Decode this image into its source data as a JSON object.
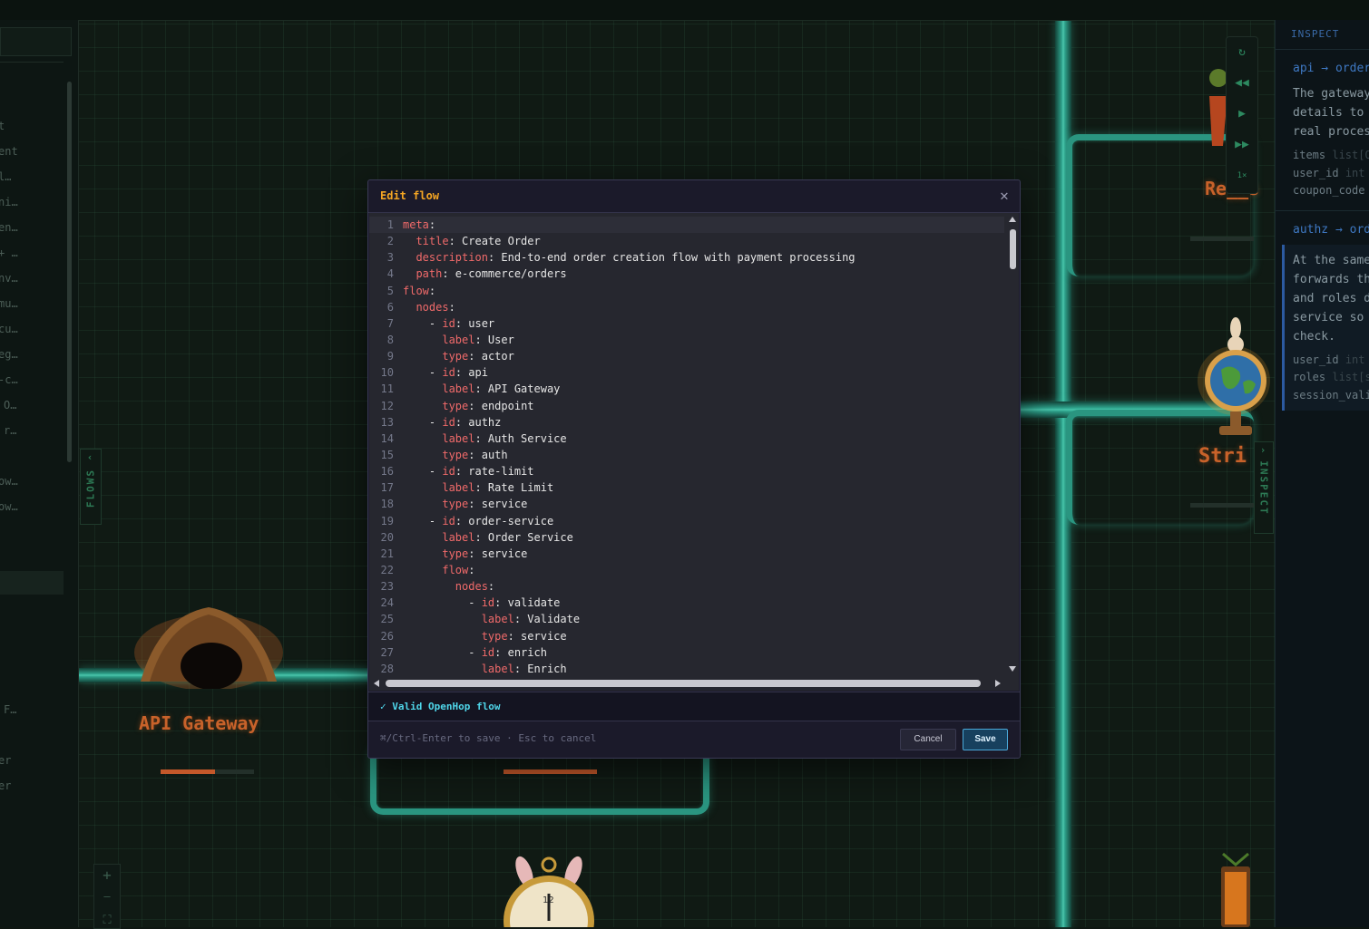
{
  "inspect_panel": {
    "title": "INSPECT",
    "edge1": {
      "title": "api → order",
      "text": "The gateway\ndetails to\nreal proces",
      "fields": [
        {
          "name": "items",
          "type": "list[O"
        },
        {
          "name": "user_id",
          "type": "int"
        },
        {
          "name": "coupon_code",
          "type": ""
        }
      ]
    },
    "edge2": {
      "title": "authz → ord",
      "text": "At the same\nforwards th\nand roles d\nservice so \ncheck.",
      "fields": [
        {
          "name": "user_id",
          "type": "int"
        },
        {
          "name": "roles",
          "type": "list[s"
        },
        {
          "name": "session_vali",
          "type": ""
        }
      ]
    }
  },
  "sidebar": {
    "items": [
      "t",
      "ent",
      "l…",
      "ni…",
      "en…",
      "+ …",
      "nv…",
      "mu…",
      "cu…",
      "eg…",
      "-c…",
      "O…",
      "r…",
      "ow…",
      "ow…",
      "F…",
      "er",
      "er"
    ]
  },
  "tabs": {
    "flows": "FLOWS",
    "inspect": "INSPECT"
  },
  "canvas": {
    "nodes": [
      {
        "label": "API Gateway"
      },
      {
        "label": "Re__s"
      },
      {
        "label": "Stri"
      }
    ],
    "controls": [
      "refresh-icon",
      "rewind-icon",
      "play-icon",
      "fast-forward-icon"
    ],
    "speed": "1×",
    "zoom_controls": [
      "+",
      "—",
      "⛶"
    ]
  },
  "modal": {
    "title": "Edit flow",
    "close": "✕",
    "code_lines": [
      [
        {
          "t": "meta",
          "k": 1
        },
        {
          "t": ":"
        }
      ],
      [
        {
          "t": "  "
        },
        {
          "t": "title",
          "k": 1
        },
        {
          "t": ": Create Order"
        }
      ],
      [
        {
          "t": "  "
        },
        {
          "t": "description",
          "k": 1
        },
        {
          "t": ": End-to-end order creation flow with payment processing"
        }
      ],
      [
        {
          "t": "  "
        },
        {
          "t": "path",
          "k": 1
        },
        {
          "t": ": e-commerce/orders"
        }
      ],
      [
        {
          "t": "flow",
          "k": 1
        },
        {
          "t": ":"
        }
      ],
      [
        {
          "t": "  "
        },
        {
          "t": "nodes",
          "k": 1
        },
        {
          "t": ":"
        }
      ],
      [
        {
          "t": "    - "
        },
        {
          "t": "id",
          "k": 1
        },
        {
          "t": ": user"
        }
      ],
      [
        {
          "t": "      "
        },
        {
          "t": "label",
          "k": 1
        },
        {
          "t": ": User"
        }
      ],
      [
        {
          "t": "      "
        },
        {
          "t": "type",
          "k": 1
        },
        {
          "t": ": actor"
        }
      ],
      [
        {
          "t": "    - "
        },
        {
          "t": "id",
          "k": 1
        },
        {
          "t": ": api"
        }
      ],
      [
        {
          "t": "      "
        },
        {
          "t": "label",
          "k": 1
        },
        {
          "t": ": API Gateway"
        }
      ],
      [
        {
          "t": "      "
        },
        {
          "t": "type",
          "k": 1
        },
        {
          "t": ": endpoint"
        }
      ],
      [
        {
          "t": "    - "
        },
        {
          "t": "id",
          "k": 1
        },
        {
          "t": ": authz"
        }
      ],
      [
        {
          "t": "      "
        },
        {
          "t": "label",
          "k": 1
        },
        {
          "t": ": Auth Service"
        }
      ],
      [
        {
          "t": "      "
        },
        {
          "t": "type",
          "k": 1
        },
        {
          "t": ": auth"
        }
      ],
      [
        {
          "t": "    - "
        },
        {
          "t": "id",
          "k": 1
        },
        {
          "t": ": rate-limit"
        }
      ],
      [
        {
          "t": "      "
        },
        {
          "t": "label",
          "k": 1
        },
        {
          "t": ": Rate Limit"
        }
      ],
      [
        {
          "t": "      "
        },
        {
          "t": "type",
          "k": 1
        },
        {
          "t": ": service"
        }
      ],
      [
        {
          "t": "    - "
        },
        {
          "t": "id",
          "k": 1
        },
        {
          "t": ": order-service"
        }
      ],
      [
        {
          "t": "      "
        },
        {
          "t": "label",
          "k": 1
        },
        {
          "t": ": Order Service"
        }
      ],
      [
        {
          "t": "      "
        },
        {
          "t": "type",
          "k": 1
        },
        {
          "t": ": service"
        }
      ],
      [
        {
          "t": "      "
        },
        {
          "t": "flow",
          "k": 1
        },
        {
          "t": ":"
        }
      ],
      [
        {
          "t": "        "
        },
        {
          "t": "nodes",
          "k": 1
        },
        {
          "t": ":"
        }
      ],
      [
        {
          "t": "          - "
        },
        {
          "t": "id",
          "k": 1
        },
        {
          "t": ": validate"
        }
      ],
      [
        {
          "t": "            "
        },
        {
          "t": "label",
          "k": 1
        },
        {
          "t": ": Validate"
        }
      ],
      [
        {
          "t": "            "
        },
        {
          "t": "type",
          "k": 1
        },
        {
          "t": ": service"
        }
      ],
      [
        {
          "t": "          - "
        },
        {
          "t": "id",
          "k": 1
        },
        {
          "t": ": enrich"
        }
      ],
      [
        {
          "t": "            "
        },
        {
          "t": "label",
          "k": 1
        },
        {
          "t": ": Enrich"
        }
      ]
    ],
    "validation": "✓ Valid OpenHop flow",
    "hint": "⌘/Ctrl-Enter to save · Esc to cancel",
    "cancel_label": "Cancel",
    "save_label": "Save"
  },
  "colors": {
    "accent": "#f5a623",
    "valid": "#4fd6ea",
    "key": "#f06a6a",
    "pipe": "#2ea08a"
  }
}
